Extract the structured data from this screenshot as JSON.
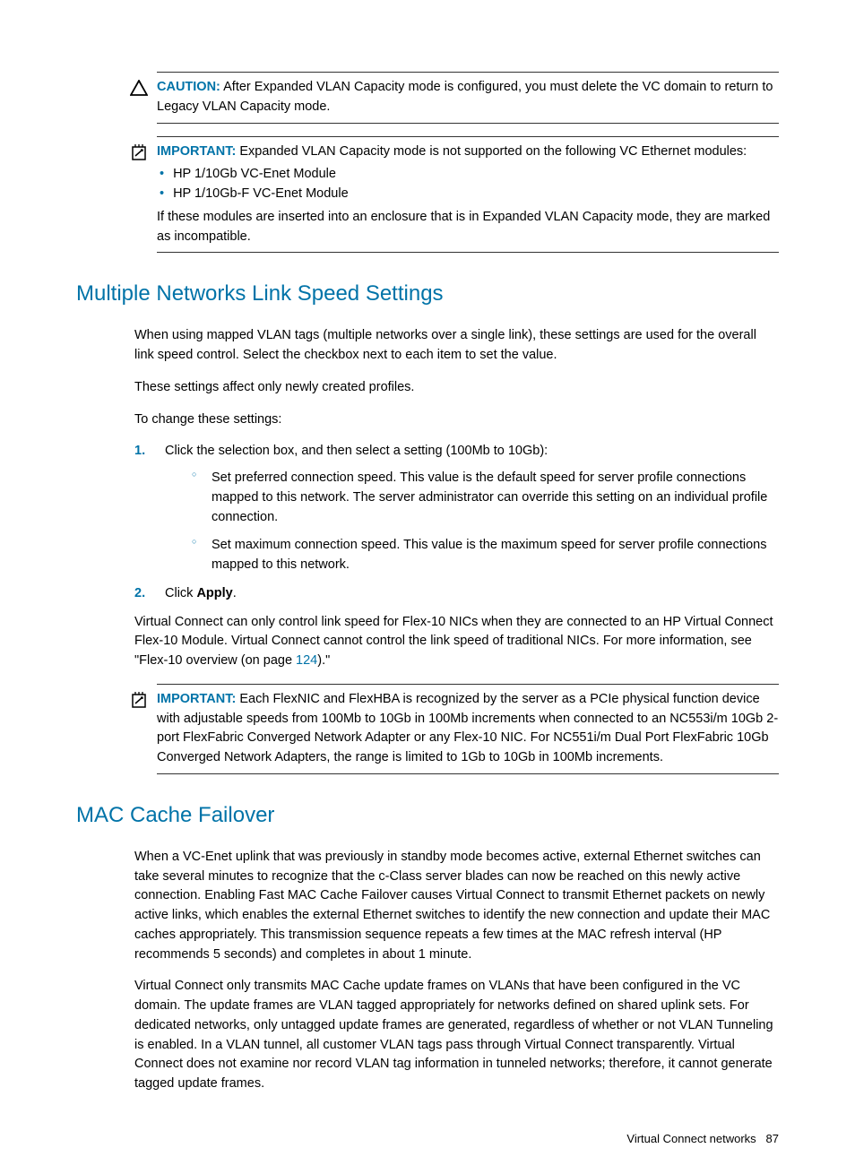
{
  "caution": {
    "label": "CAUTION:",
    "text": "After Expanded VLAN Capacity mode is configured, you must delete the VC domain to return to Legacy VLAN Capacity mode."
  },
  "important1": {
    "label": "IMPORTANT:",
    "intro": "Expanded VLAN Capacity mode is not supported on the following VC Ethernet modules:",
    "bullets": [
      "HP 1/10Gb VC-Enet Module",
      "HP 1/10Gb-F VC-Enet Module"
    ],
    "closing": "If these modules are inserted into an enclosure that is in Expanded VLAN Capacity mode, they are marked as incompatible."
  },
  "section1": {
    "heading": "Multiple Networks Link Speed Settings",
    "p1": "When using mapped VLAN tags (multiple networks over a single link), these settings are used for the overall link speed control. Select the checkbox next to each item to set the value.",
    "p2": "These settings affect only newly created profiles.",
    "p3": "To change these settings:",
    "step1": "Click the selection box, and then select a setting (100Mb to 10Gb):",
    "sub1": "Set preferred connection speed. This value is the default speed for server profile connections mapped to this network. The server administrator can override this setting on an individual profile connection.",
    "sub2": "Set maximum connection speed. This value is the maximum speed for server profile connections mapped to this network.",
    "step2_prefix": "Click ",
    "step2_bold": "Apply",
    "p4_prefix": "Virtual Connect can only control link speed for Flex-10 NICs when they are connected to an HP Virtual Connect Flex-10 Module. Virtual Connect cannot control the link speed of traditional NICs. For more information, see \"Flex-10 overview (on page ",
    "p4_link": "124",
    "p4_suffix": ").\""
  },
  "important2": {
    "label": "IMPORTANT:",
    "text": "Each FlexNIC and FlexHBA is recognized by the server as a PCIe physical function device with adjustable speeds from 100Mb to 10Gb in 100Mb increments when connected to an NC553i/m 10Gb 2-port FlexFabric Converged Network Adapter or any Flex-10 NIC. For NC551i/m Dual Port FlexFabric 10Gb Converged Network Adapters, the range is limited to 1Gb to 10Gb in 100Mb increments."
  },
  "section2": {
    "heading": "MAC Cache Failover",
    "p1": "When a VC-Enet uplink that was previously in standby mode becomes active, external Ethernet switches can take several minutes to recognize that the c-Class server blades can now be reached on this newly active connection. Enabling Fast MAC Cache Failover causes Virtual Connect to transmit Ethernet packets on newly active links, which enables the external Ethernet switches to identify the new connection and update their MAC caches appropriately. This transmission sequence repeats a few times at the MAC refresh interval (HP recommends 5 seconds) and completes in about 1 minute.",
    "p2": "Virtual Connect only transmits MAC Cache update frames on VLANs that have been configured in the VC domain. The update frames are VLAN tagged appropriately for networks defined on shared uplink sets. For dedicated networks, only untagged update frames are generated, regardless of whether or not VLAN Tunneling is enabled. In a VLAN tunnel, all customer VLAN tags pass through Virtual Connect transparently. Virtual Connect does not examine nor record VLAN tag information in tunneled networks; therefore, it cannot generate tagged update frames."
  },
  "footer": {
    "text": "Virtual Connect networks",
    "page": "87"
  }
}
